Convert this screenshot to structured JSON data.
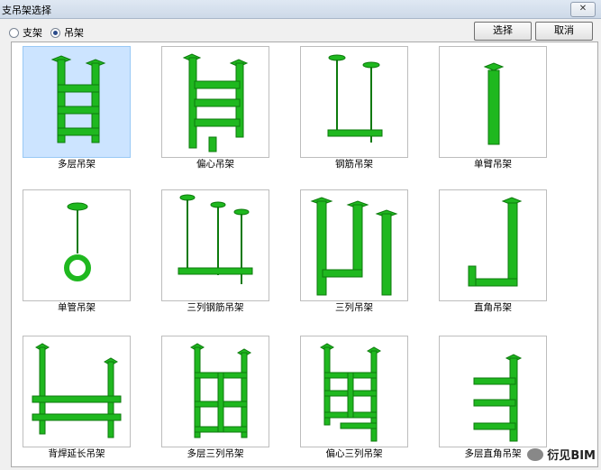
{
  "window": {
    "title": "支吊架选择",
    "close_label": "✕"
  },
  "options": {
    "radio_support": "支架",
    "radio_hanger": "吊架",
    "selected": "吊架"
  },
  "buttons": {
    "select": "选择",
    "cancel": "取消"
  },
  "items": [
    "多层吊架",
    "偏心吊架",
    "钢筋吊架",
    "单臂吊架",
    "单管吊架",
    "三列钢筋吊架",
    "三列吊架",
    "直角吊架",
    "背焊延长吊架",
    "多层三列吊架",
    "偏心三列吊架",
    "多层直角吊架"
  ],
  "selected_index": 0,
  "colors": {
    "green": "#1fb81f",
    "dark_green": "#0d7a0d",
    "selection": "#cce4ff"
  },
  "watermark": {
    "text": "衍见BIM"
  }
}
